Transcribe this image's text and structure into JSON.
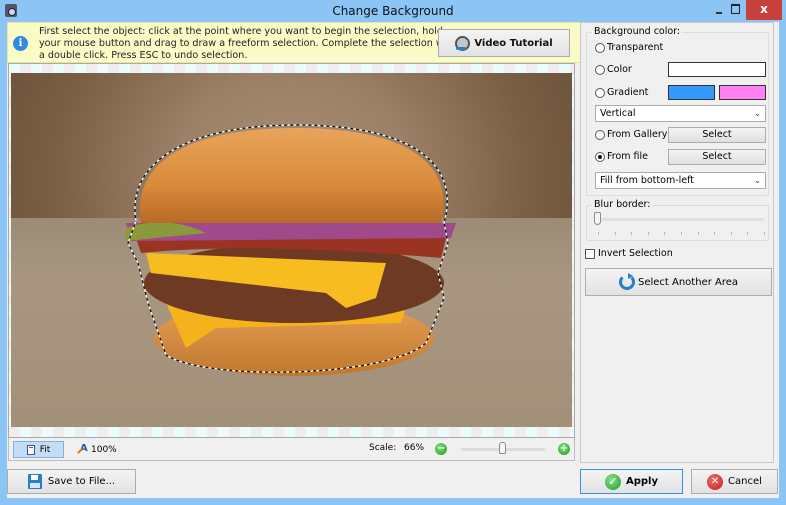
{
  "window": {
    "title": "Change Background",
    "icons": {
      "app": "camera-app-icon",
      "minimize": "minimize-icon",
      "maximize": "maximize-icon",
      "close": "close-icon"
    },
    "close_glyph": "x"
  },
  "hint": {
    "icon": "info-icon",
    "icon_glyph": "i",
    "text": "First select the object: click at the point where you want to begin the selection, hold your mouse button and drag to draw a freeform selection. Complete the selection with a double click. Press ESC to undo selection.",
    "video_tutorial_label": "Video Tutorial",
    "video_tutorial_icon": "webcam-icon"
  },
  "canvas": {
    "image_subject": "cheeseburger with freeform selection outline",
    "background_pattern": "transparency checkerboard"
  },
  "statusbar": {
    "fit_label": "Fit",
    "zoom100_label": "100%",
    "scale_label": "Scale:",
    "scale_value": "66%",
    "scale_fraction": 0.5,
    "zoom_out_glyph": "−",
    "zoom_in_glyph": "+"
  },
  "panel": {
    "background_color": {
      "title": "Background color:",
      "options": [
        {
          "label": "Transparent",
          "checked": false
        },
        {
          "label": "Color",
          "checked": false
        },
        {
          "label": "Gradient",
          "checked": false
        },
        {
          "label": "From Gallery",
          "checked": false
        },
        {
          "label": "From file",
          "checked": true
        }
      ],
      "color_swatch": "#ffffff",
      "gradient_start": "#3399ff",
      "gradient_end": "#ff80f0",
      "gradient_direction": "Vertical",
      "gallery_select_label": "Select",
      "file_select_label": "Select",
      "fill_mode": "Fill from bottom-left"
    },
    "blur": {
      "title": "Blur border:",
      "value_fraction": 0.0
    },
    "invert_selection": {
      "label": "Invert Selection",
      "checked": false
    },
    "select_another_area_label": "Select Another Area"
  },
  "footer": {
    "save_label": "Save to File...",
    "apply_label": "Apply",
    "cancel_label": "Cancel",
    "apply_glyph": "✓",
    "cancel_glyph": "✕"
  }
}
